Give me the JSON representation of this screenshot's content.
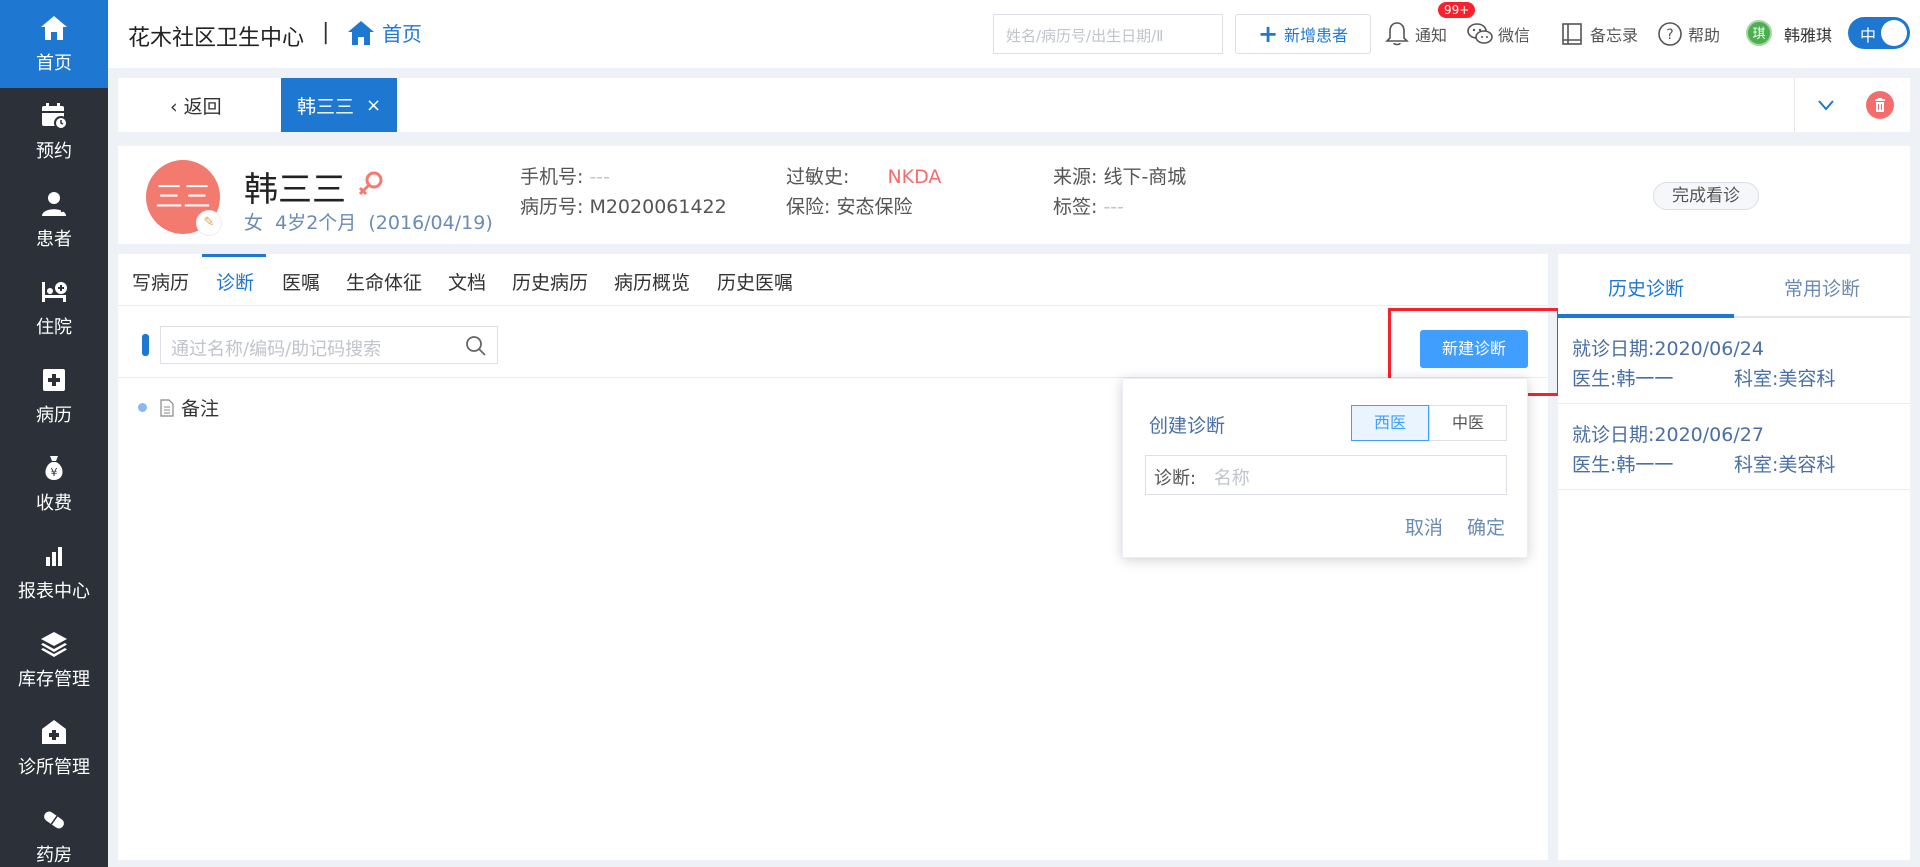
{
  "sidebar": {
    "items": [
      {
        "label": "首页",
        "icon": "home-icon"
      },
      {
        "label": "预约",
        "icon": "calendar-icon"
      },
      {
        "label": "患者",
        "icon": "patient-icon"
      },
      {
        "label": "住院",
        "icon": "bed-icon"
      },
      {
        "label": "病历",
        "icon": "medical-record-icon"
      },
      {
        "label": "收费",
        "icon": "money-bag-icon"
      },
      {
        "label": "报表中心",
        "icon": "bar-chart-icon"
      },
      {
        "label": "库存管理",
        "icon": "layers-icon"
      },
      {
        "label": "诊所管理",
        "icon": "clinic-icon"
      },
      {
        "label": "药房",
        "icon": "pill-icon"
      }
    ]
  },
  "header": {
    "clinic_name": "花木社区卫生中心",
    "separator": "|",
    "breadcrumb": "首页",
    "search_placeholder": "姓名/病历号/出生日期/Ⅱ",
    "new_patient_label": "新增患者",
    "notify_label": "通知",
    "notify_badge": "99+",
    "wechat_label": "微信",
    "memo_label": "备忘录",
    "help_label": "帮助",
    "avatar_char": "琪",
    "username": "韩雅琪",
    "lang_label": "中"
  },
  "tabbar": {
    "back_label": "返回",
    "patient_tab": "韩三三",
    "close_symbol": "×"
  },
  "patient": {
    "avatar_text": "三三",
    "name": "韩三三",
    "gender": "女",
    "age": "4岁2个月",
    "birth": "(2016/04/19)",
    "phone_label": "手机号:",
    "phone_value": "---",
    "record_label": "病历号:",
    "record_value": "M2020061422",
    "allergy_label": "过敏史:",
    "allergy_value": "NKDA",
    "insurance_label": "保险:",
    "insurance_value": "安态保险",
    "source_label": "来源:",
    "source_value": "线下-商城",
    "tag_label": "标签:",
    "tag_value": "---",
    "finish_label": "完成看诊"
  },
  "main": {
    "tabs": [
      "写病历",
      "诊断",
      "医嘱",
      "生命体征",
      "文档",
      "历史病历",
      "病历概览",
      "历史医嘱"
    ],
    "active_tab": "诊断",
    "search_placeholder": "通过名称/编码/助记码搜索",
    "new_diag_label": "新建诊断",
    "remark_label": "备注"
  },
  "popover": {
    "title": "创建诊断",
    "seg_western": "西医",
    "seg_chinese": "中医",
    "input_label": "诊断:",
    "input_placeholder": "名称",
    "cancel_label": "取消",
    "confirm_label": "确定"
  },
  "right_panel": {
    "tab_history": "历史诊断",
    "tab_common": "常用诊断",
    "records": [
      {
        "date": "就诊日期:2020/06/24",
        "doctor": "医生:韩一一",
        "dept": "科室:美容科"
      },
      {
        "date": "就诊日期:2020/06/27",
        "doctor": "医生:韩一一",
        "dept": "科室:美容科"
      }
    ]
  },
  "colors": {
    "sidebar_bg": "#2b3039",
    "accent": "#1e78d2",
    "button_blue": "#409eff",
    "allergy_red": "#f56c6c",
    "avatar_red": "#f27a6f",
    "highlight_red": "#f5222d"
  }
}
